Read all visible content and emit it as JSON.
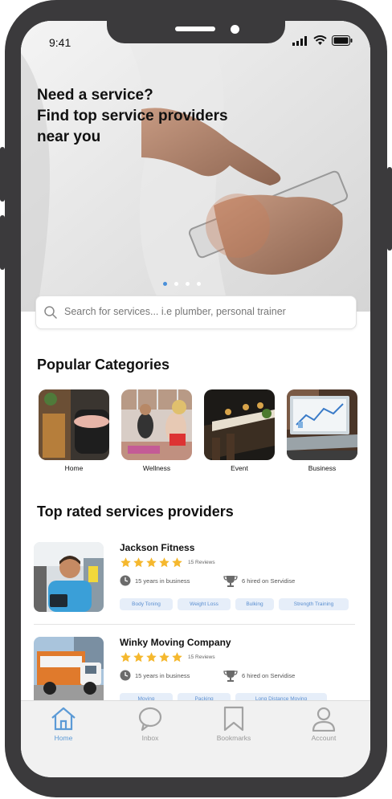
{
  "status_bar": {
    "time": "9:41"
  },
  "hero": {
    "title_lines": [
      "Need a service?",
      "Find top service providers",
      "near you"
    ],
    "carousel_total": 4,
    "carousel_active": 1
  },
  "search": {
    "placeholder": "Search for services... i.e plumber, personal trainer"
  },
  "popular": {
    "title": "Popular Categories",
    "items": [
      {
        "label": "Home"
      },
      {
        "label": "Wellness"
      },
      {
        "label": "Event"
      },
      {
        "label": "Business"
      }
    ]
  },
  "top_rated": {
    "title": "Top rated services providers",
    "providers": [
      {
        "name": "Jackson Fitness",
        "rating": 5,
        "reviews": "15 Reviews",
        "experience": "15 years in business",
        "hired": "6 hired on Servidise",
        "tags": [
          "Body Toning",
          "Weight Loss",
          "Bulking",
          "Strength Training"
        ]
      },
      {
        "name": "Winky Moving Company",
        "rating": 5,
        "reviews": "15 Reviews",
        "experience": "15 years in business",
        "hired": "6 hired on Servidise",
        "tags": [
          "Moving",
          "Packing",
          "Long Distance Moving"
        ]
      }
    ]
  },
  "tabbar": {
    "tabs": [
      {
        "label": "Home",
        "icon": "home-icon",
        "active": true
      },
      {
        "label": "Inbox",
        "icon": "chat-bubble-icon",
        "active": false
      },
      {
        "label": "Bookmarks",
        "icon": "bookmark-icon",
        "active": false
      },
      {
        "label": "Account",
        "icon": "user-icon",
        "active": false
      }
    ]
  },
  "colors": {
    "accent": "#5b9ad6",
    "star": "#f5b82e",
    "tag_bg": "#e6eef9",
    "frame": "#3b3a3c"
  }
}
